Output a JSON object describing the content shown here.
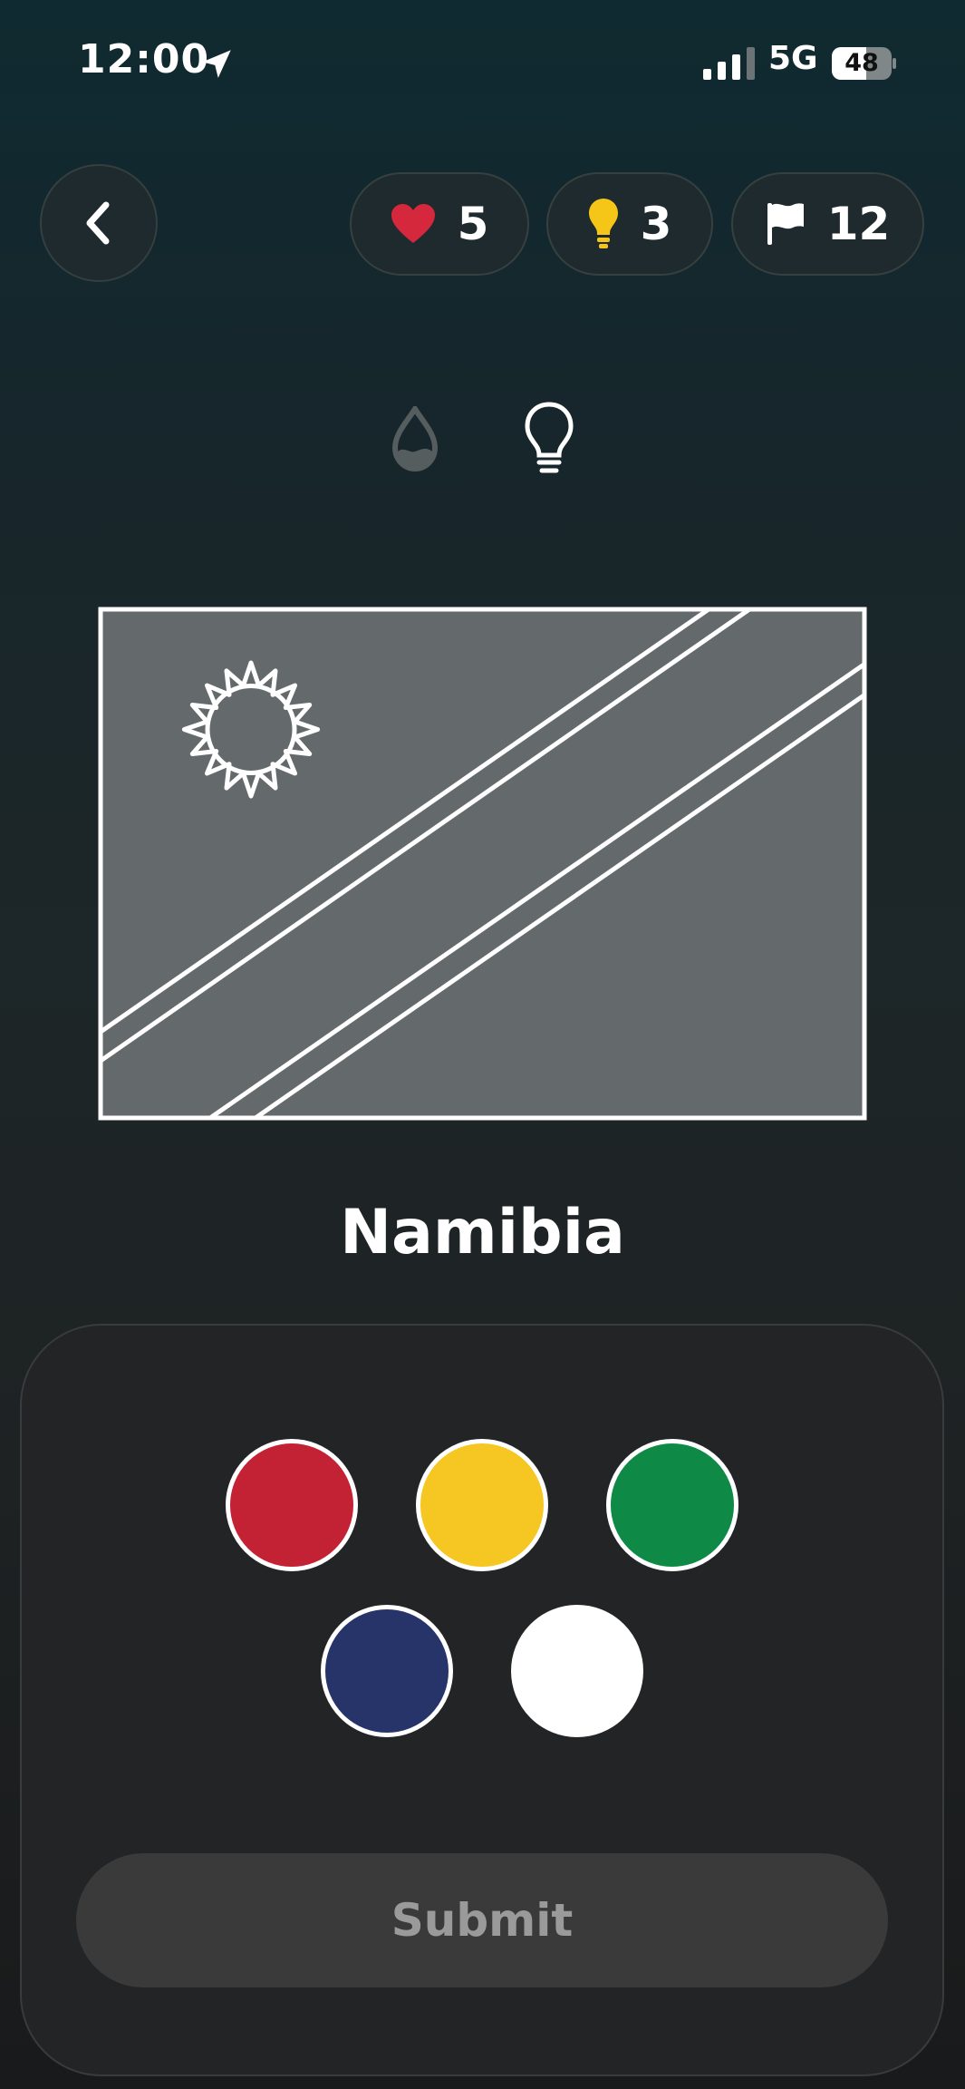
{
  "status_bar": {
    "time": "12:00",
    "network": "5G",
    "battery": "48",
    "icons": [
      "location-arrow-icon",
      "signal-bars-icon",
      "battery-icon"
    ]
  },
  "header": {
    "back_icon": "chevron-left-icon",
    "lives": {
      "icon": "heart-icon",
      "count": "5",
      "color": "#d6283c"
    },
    "hints": {
      "icon": "lightbulb-icon",
      "count": "3",
      "color": "#f5c518"
    },
    "flags": {
      "icon": "flag-icon",
      "count": "12"
    }
  },
  "tools": {
    "paint_icon": "paint-drop-icon",
    "hint_icon": "lightbulb-outline-icon"
  },
  "flag": {
    "fill_color": "#646a6b",
    "outline_color": "#ffffff"
  },
  "country": {
    "name": "Namibia"
  },
  "palette": {
    "colors": [
      {
        "name": "red",
        "hex": "#c32234"
      },
      {
        "name": "yellow",
        "hex": "#f6c722"
      },
      {
        "name": "green",
        "hex": "#0f8a46"
      },
      {
        "name": "blue",
        "hex": "#27346a"
      },
      {
        "name": "white",
        "hex": "#ffffff"
      }
    ]
  },
  "actions": {
    "submit_label": "Submit"
  }
}
